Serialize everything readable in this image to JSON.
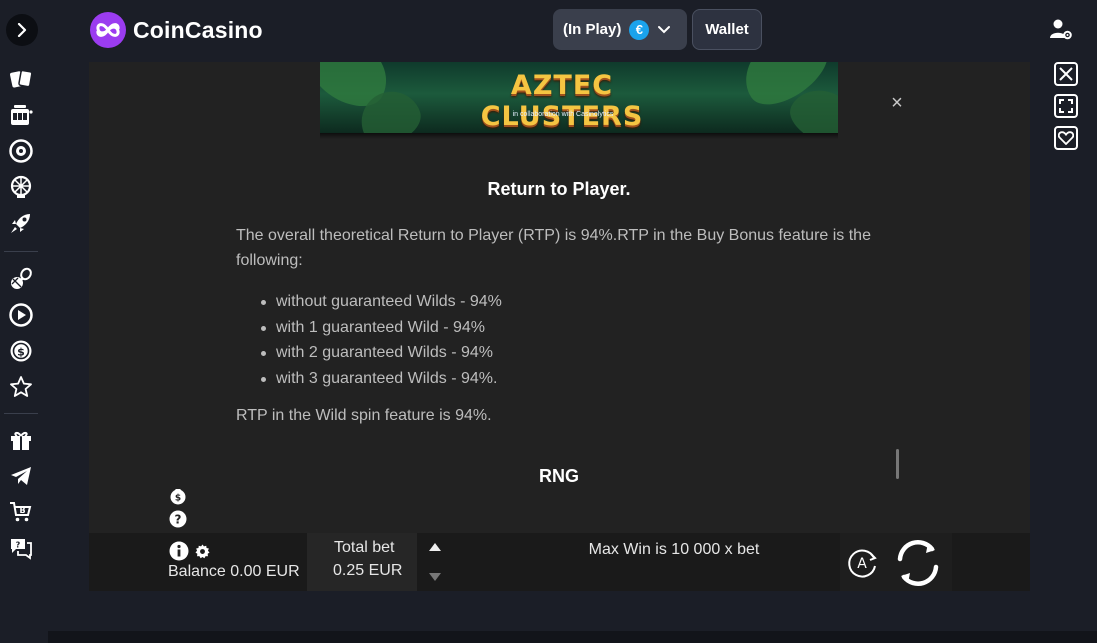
{
  "header": {
    "brand": "CoinCasino",
    "play_mode": "(In Play)",
    "currency_symbol": "€",
    "wallet_label": "Wallet"
  },
  "colors": {
    "background": "#1b1e27",
    "brand_purple": "#9b3cf0",
    "game_bg": "#222222",
    "currency_blue": "#1aa3ec"
  },
  "sidebar": {
    "icons": [
      "cards-icon",
      "slot-machine-icon",
      "roulette-icon",
      "wheel-icon",
      "rocket-icon",
      "sports-icon",
      "play-circle-icon",
      "coin-icon",
      "star-icon",
      "gift-icon",
      "telegram-icon",
      "crypto-cart-icon",
      "chat-icon"
    ]
  },
  "game": {
    "banner_title": "AZTEC CLUSTERS",
    "banner_subtitle": "in collaboration with  Casinolytics",
    "info": {
      "title": "Return to Player.",
      "paragraph": "The overall theoretical Return to Player (RTP) is 94%.RTP in the Buy Bonus feature is the following:",
      "list": [
        "without guaranteed Wilds - 94%",
        "with 1 guaranteed Wild - 94%",
        "with 2 guaranteed Wilds - 94%",
        "with 3 guaranteed Wilds - 94%."
      ],
      "paragraph2": "RTP in the Wild spin feature is 94%.",
      "heading2": "RNG"
    },
    "bottom_bar": {
      "balance": "Balance 0.00 EUR",
      "total_bet_label": "Total bet",
      "total_bet_value": "0.25 EUR",
      "max_win": "Max Win is 10 000 x bet",
      "autoplay_letter": "A"
    }
  },
  "right_controls": [
    "close-icon",
    "fullscreen-icon",
    "favorite-heart-icon"
  ]
}
